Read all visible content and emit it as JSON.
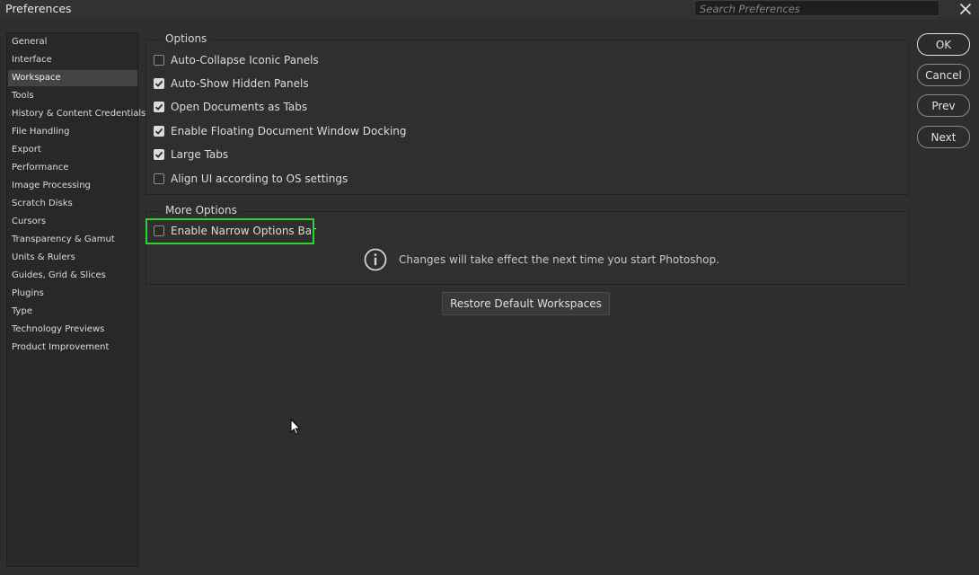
{
  "window": {
    "title": "Preferences"
  },
  "search": {
    "placeholder": "Search Preferences"
  },
  "sidebar": {
    "selected": "Workspace",
    "items": [
      {
        "label": "General"
      },
      {
        "label": "Interface"
      },
      {
        "label": "Workspace"
      },
      {
        "label": "Tools"
      },
      {
        "label": "History & Content Credentials"
      },
      {
        "label": "File Handling"
      },
      {
        "label": "Export"
      },
      {
        "label": "Performance"
      },
      {
        "label": "Image Processing"
      },
      {
        "label": "Scratch Disks"
      },
      {
        "label": "Cursors"
      },
      {
        "label": "Transparency & Gamut"
      },
      {
        "label": "Units & Rulers"
      },
      {
        "label": "Guides, Grid & Slices"
      },
      {
        "label": "Plugins"
      },
      {
        "label": "Type"
      },
      {
        "label": "Technology Previews"
      },
      {
        "label": "Product Improvement"
      }
    ]
  },
  "options_group": {
    "title": "Options",
    "items": [
      {
        "label": "Auto-Collapse Iconic Panels",
        "checked": false
      },
      {
        "label": "Auto-Show Hidden Panels",
        "checked": true
      },
      {
        "label": "Open Documents as Tabs",
        "checked": true
      },
      {
        "label": "Enable Floating Document Window Docking",
        "checked": true
      },
      {
        "label": "Large Tabs",
        "checked": true
      },
      {
        "label": "Align UI according to OS settings",
        "checked": false
      }
    ]
  },
  "more_options_group": {
    "title": "More Options",
    "items": [
      {
        "label": "Enable Narrow Options Bar",
        "checked": false
      }
    ],
    "info_text": "Changes will take effect the next time you start Photoshop."
  },
  "restore_button": {
    "label": "Restore Default Workspaces"
  },
  "buttons": {
    "ok": "OK",
    "cancel": "Cancel",
    "prev": "Prev",
    "next": "Next"
  },
  "icons": {
    "close": "close-icon",
    "info": "info-icon",
    "check": "checkmark-icon",
    "cursor": "mouse-pointer-icon"
  },
  "colors": {
    "background": "#2e2e2e",
    "selected_item": "#444444",
    "highlight_box": "#2fd32f"
  }
}
